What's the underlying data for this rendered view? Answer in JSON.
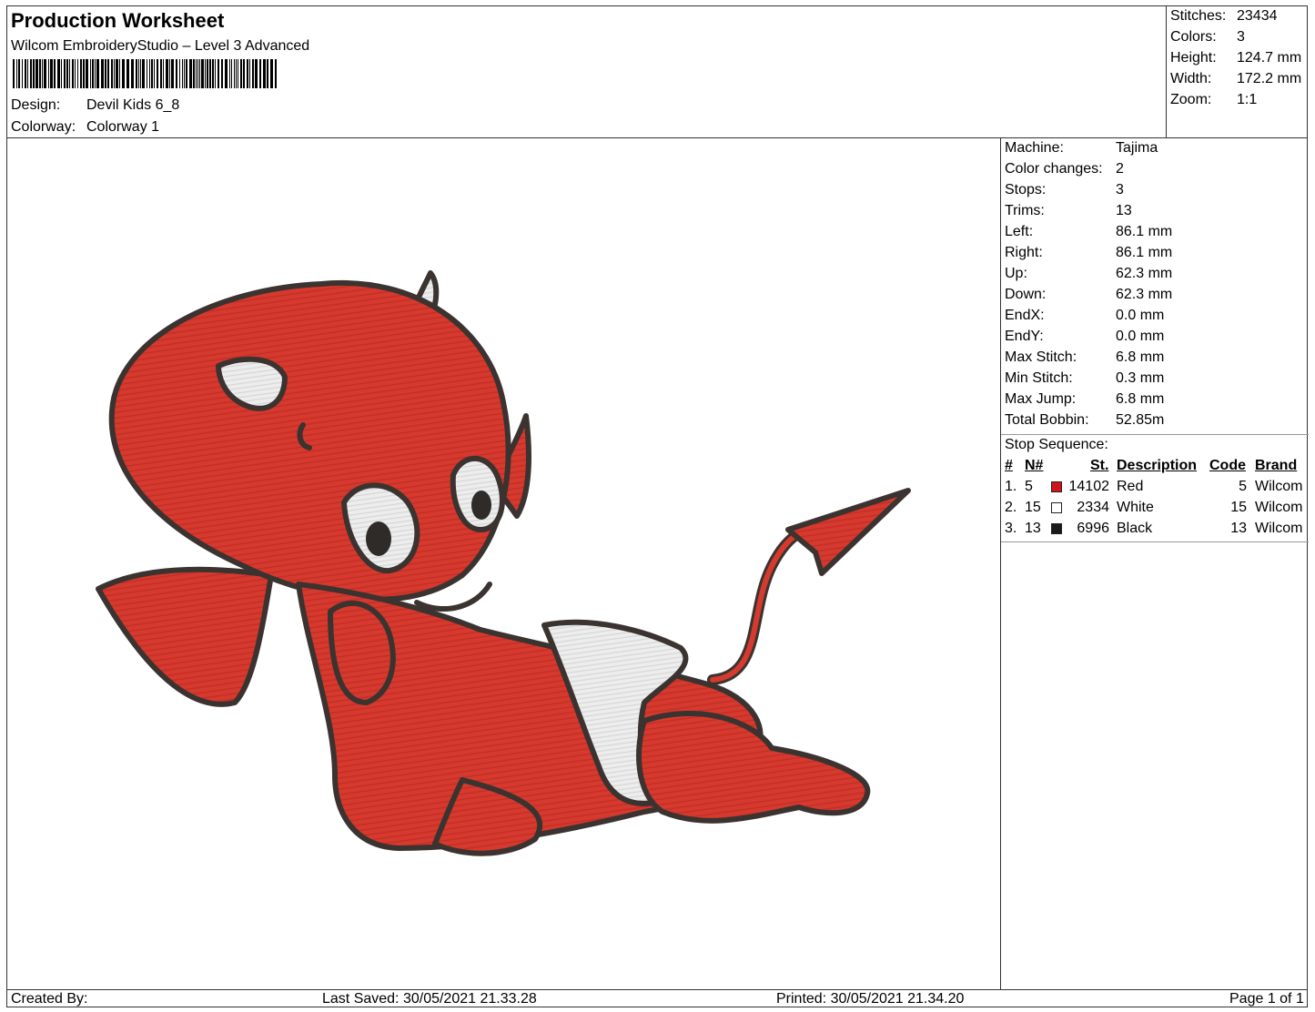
{
  "header": {
    "title": "Production Worksheet",
    "software": "Wilcom EmbroideryStudio – Level 3 Advanced",
    "design_label": "Design:",
    "design_value": "Devil Kids 6_8",
    "colorway_label": "Colorway:",
    "colorway_value": "Colorway 1"
  },
  "summary": [
    {
      "label": "Stitches:",
      "value": "23434"
    },
    {
      "label": "Colors:",
      "value": "3"
    },
    {
      "label": "Height:",
      "value": "124.7 mm"
    },
    {
      "label": "Width:",
      "value": "172.2 mm"
    },
    {
      "label": "Zoom:",
      "value": "1:1"
    }
  ],
  "machine_info": [
    {
      "label": "Machine:",
      "value": "Tajima"
    },
    {
      "label": "Color changes:",
      "value": "2"
    },
    {
      "label": "Stops:",
      "value": "3"
    },
    {
      "label": "Trims:",
      "value": "13"
    },
    {
      "label": "Left:",
      "value": "86.1 mm"
    },
    {
      "label": "Right:",
      "value": "86.1 mm"
    },
    {
      "label": "Up:",
      "value": "62.3 mm"
    },
    {
      "label": "Down:",
      "value": "62.3 mm"
    },
    {
      "label": "EndX:",
      "value": "0.0 mm"
    },
    {
      "label": "EndY:",
      "value": "0.0 mm"
    },
    {
      "label": "Max Stitch:",
      "value": "6.8 mm"
    },
    {
      "label": "Min Stitch:",
      "value": "0.3 mm"
    },
    {
      "label": "Max Jump:",
      "value": "6.8 mm"
    },
    {
      "label": "Total Bobbin:",
      "value": "52.85m"
    }
  ],
  "stop_sequence": {
    "title": "Stop Sequence:",
    "columns": {
      "num": "#",
      "needle": "N#",
      "stitches": "St.",
      "description": "Description",
      "code": "Code",
      "brand": "Brand"
    },
    "rows": [
      {
        "num": "1.",
        "needle": "5",
        "color": "#d0141c",
        "stitches": "14102",
        "description": "Red",
        "code": "5",
        "brand": "Wilcom"
      },
      {
        "num": "2.",
        "needle": "15",
        "color": "#ffffff",
        "stitches": "2334",
        "description": "White",
        "code": "15",
        "brand": "Wilcom"
      },
      {
        "num": "3.",
        "needle": "13",
        "color": "#1a1a1a",
        "stitches": "6996",
        "description": "Black",
        "code": "13",
        "brand": "Wilcom"
      }
    ]
  },
  "footer": {
    "created_by": "Created By:",
    "last_saved": "Last Saved: 30/05/2021 21.33.28",
    "printed": "Printed: 30/05/2021 21.34.20",
    "page": "Page 1 of 1"
  },
  "design_colors": {
    "red": "#d6392e",
    "outline": "#3a3330",
    "white": "#ececec"
  }
}
